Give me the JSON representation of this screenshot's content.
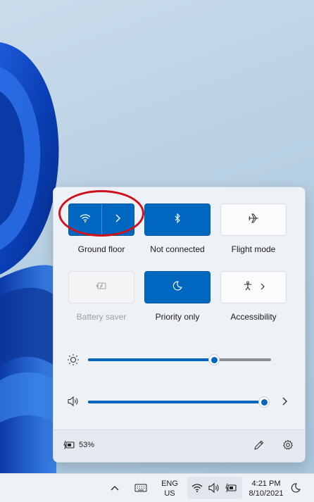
{
  "tiles": [
    {
      "label": "Ground floor",
      "icon": "wifi-icon",
      "secondary_icon": "chevron-right-icon",
      "state": "on"
    },
    {
      "label": "Not connected",
      "icon": "bluetooth-icon",
      "state": "on"
    },
    {
      "label": "Flight mode",
      "icon": "airplane-icon",
      "state": "off"
    },
    {
      "label": "Battery saver",
      "icon": "battery-saver-icon",
      "state": "disabled"
    },
    {
      "label": "Priority only",
      "icon": "moon-icon",
      "state": "on"
    },
    {
      "label": "Accessibility",
      "icon": "accessibility-icon",
      "secondary_icon": "chevron-right-icon",
      "state": "off"
    }
  ],
  "sliders": {
    "brightness": {
      "icon": "sun-icon",
      "level_percent": 69
    },
    "volume": {
      "icon": "speaker-icon",
      "level_percent": 100,
      "trailing_icon": "chevron-right-icon"
    }
  },
  "footer": {
    "battery_icon": "battery-charging-icon",
    "battery_text": "53%",
    "edit_icon": "pencil-icon",
    "settings_icon": "gear-icon"
  },
  "taskbar": {
    "overflow_icon": "chevron-up-icon",
    "keyboard_icon": "keyboard-icon",
    "language_line1": "ENG",
    "language_line2": "US",
    "tray_icons": [
      "wifi-icon",
      "speaker-icon",
      "battery-charging-icon"
    ],
    "time": "4:21 PM",
    "date": "8/10/2021",
    "focus_icon": "moon-icon"
  },
  "colors": {
    "accent": "#0067c0",
    "highlight_ring": "#d0101b"
  }
}
